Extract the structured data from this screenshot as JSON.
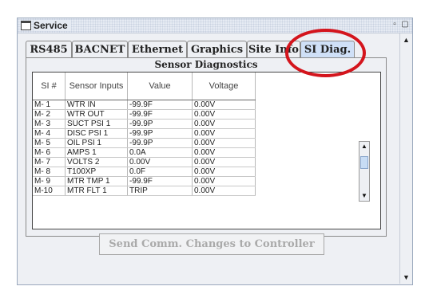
{
  "window": {
    "title": "Service"
  },
  "tabs": [
    {
      "label": "RS485",
      "active": false
    },
    {
      "label": "BACNET",
      "active": false
    },
    {
      "label": "Ethernet",
      "active": false
    },
    {
      "label": "Graphics",
      "active": false
    },
    {
      "label": "Site Info",
      "active": false
    },
    {
      "label": "SI Diag.",
      "active": true
    }
  ],
  "panel": {
    "title": "Sensor Diagnostics",
    "columns": [
      "SI #",
      "Sensor Inputs",
      "Value",
      "Voltage"
    ],
    "rows": [
      [
        "M- 1",
        "WTR IN",
        "-99.9F",
        "0.00V"
      ],
      [
        "M- 2",
        "WTR OUT",
        "-99.9F",
        "0.00V"
      ],
      [
        "M- 3",
        "SUCT PSI 1",
        "-99.9P",
        "0.00V"
      ],
      [
        "M- 4",
        "DISC PSI 1",
        "-99.9P",
        "0.00V"
      ],
      [
        "M- 5",
        "OIL PSI 1",
        "-99.9P",
        "0.00V"
      ],
      [
        "M- 6",
        "AMPS 1",
        "0.0A",
        "0.00V"
      ],
      [
        "M- 7",
        "VOLTS 2",
        "0.00V",
        "0.00V"
      ],
      [
        "M- 8",
        "T100XP",
        "0.0F",
        "0.00V"
      ],
      [
        "M- 9",
        "MTR TMP 1",
        "-99.9F",
        "0.00V"
      ],
      [
        "M-10",
        "MTR FLT 1",
        "TRIP",
        "0.00V"
      ]
    ]
  },
  "send_button": {
    "label": "Send Comm. Changes to Controller",
    "enabled": false
  },
  "icons": {
    "window": "window-icon",
    "restore": "restore-icon",
    "maximize": "maximize-icon",
    "scroll_up": "arrow-up-icon",
    "scroll_down": "arrow-down-icon"
  },
  "colors": {
    "highlight": "#d4151d",
    "active_tab": "#cfe0f7",
    "disabled_text": "#aaaaaa"
  }
}
